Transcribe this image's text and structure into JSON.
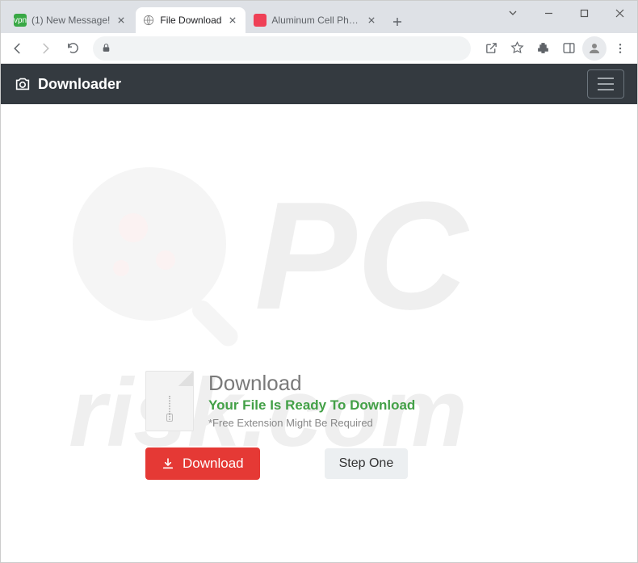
{
  "browser": {
    "tabs": [
      {
        "label": "(1) New Message!",
        "favicon_bg": "#39a845",
        "favicon_text": "vpn"
      },
      {
        "label": "File Download",
        "favicon_bg": "#ffffff",
        "favicon_text": ""
      },
      {
        "label": "Aluminum Cell Phone H",
        "favicon_bg": "#ef4056",
        "favicon_text": ""
      }
    ],
    "omnibox_placeholder": ""
  },
  "header": {
    "brand": "Downloader"
  },
  "download": {
    "title": "Download",
    "ready": "Your File Is Ready To Download",
    "note": "*Free Extension Might Be Required",
    "button_label": "Download",
    "step_label": "Step One"
  },
  "watermark": {
    "text_top": "PC",
    "text_bottom": "risk.com"
  }
}
